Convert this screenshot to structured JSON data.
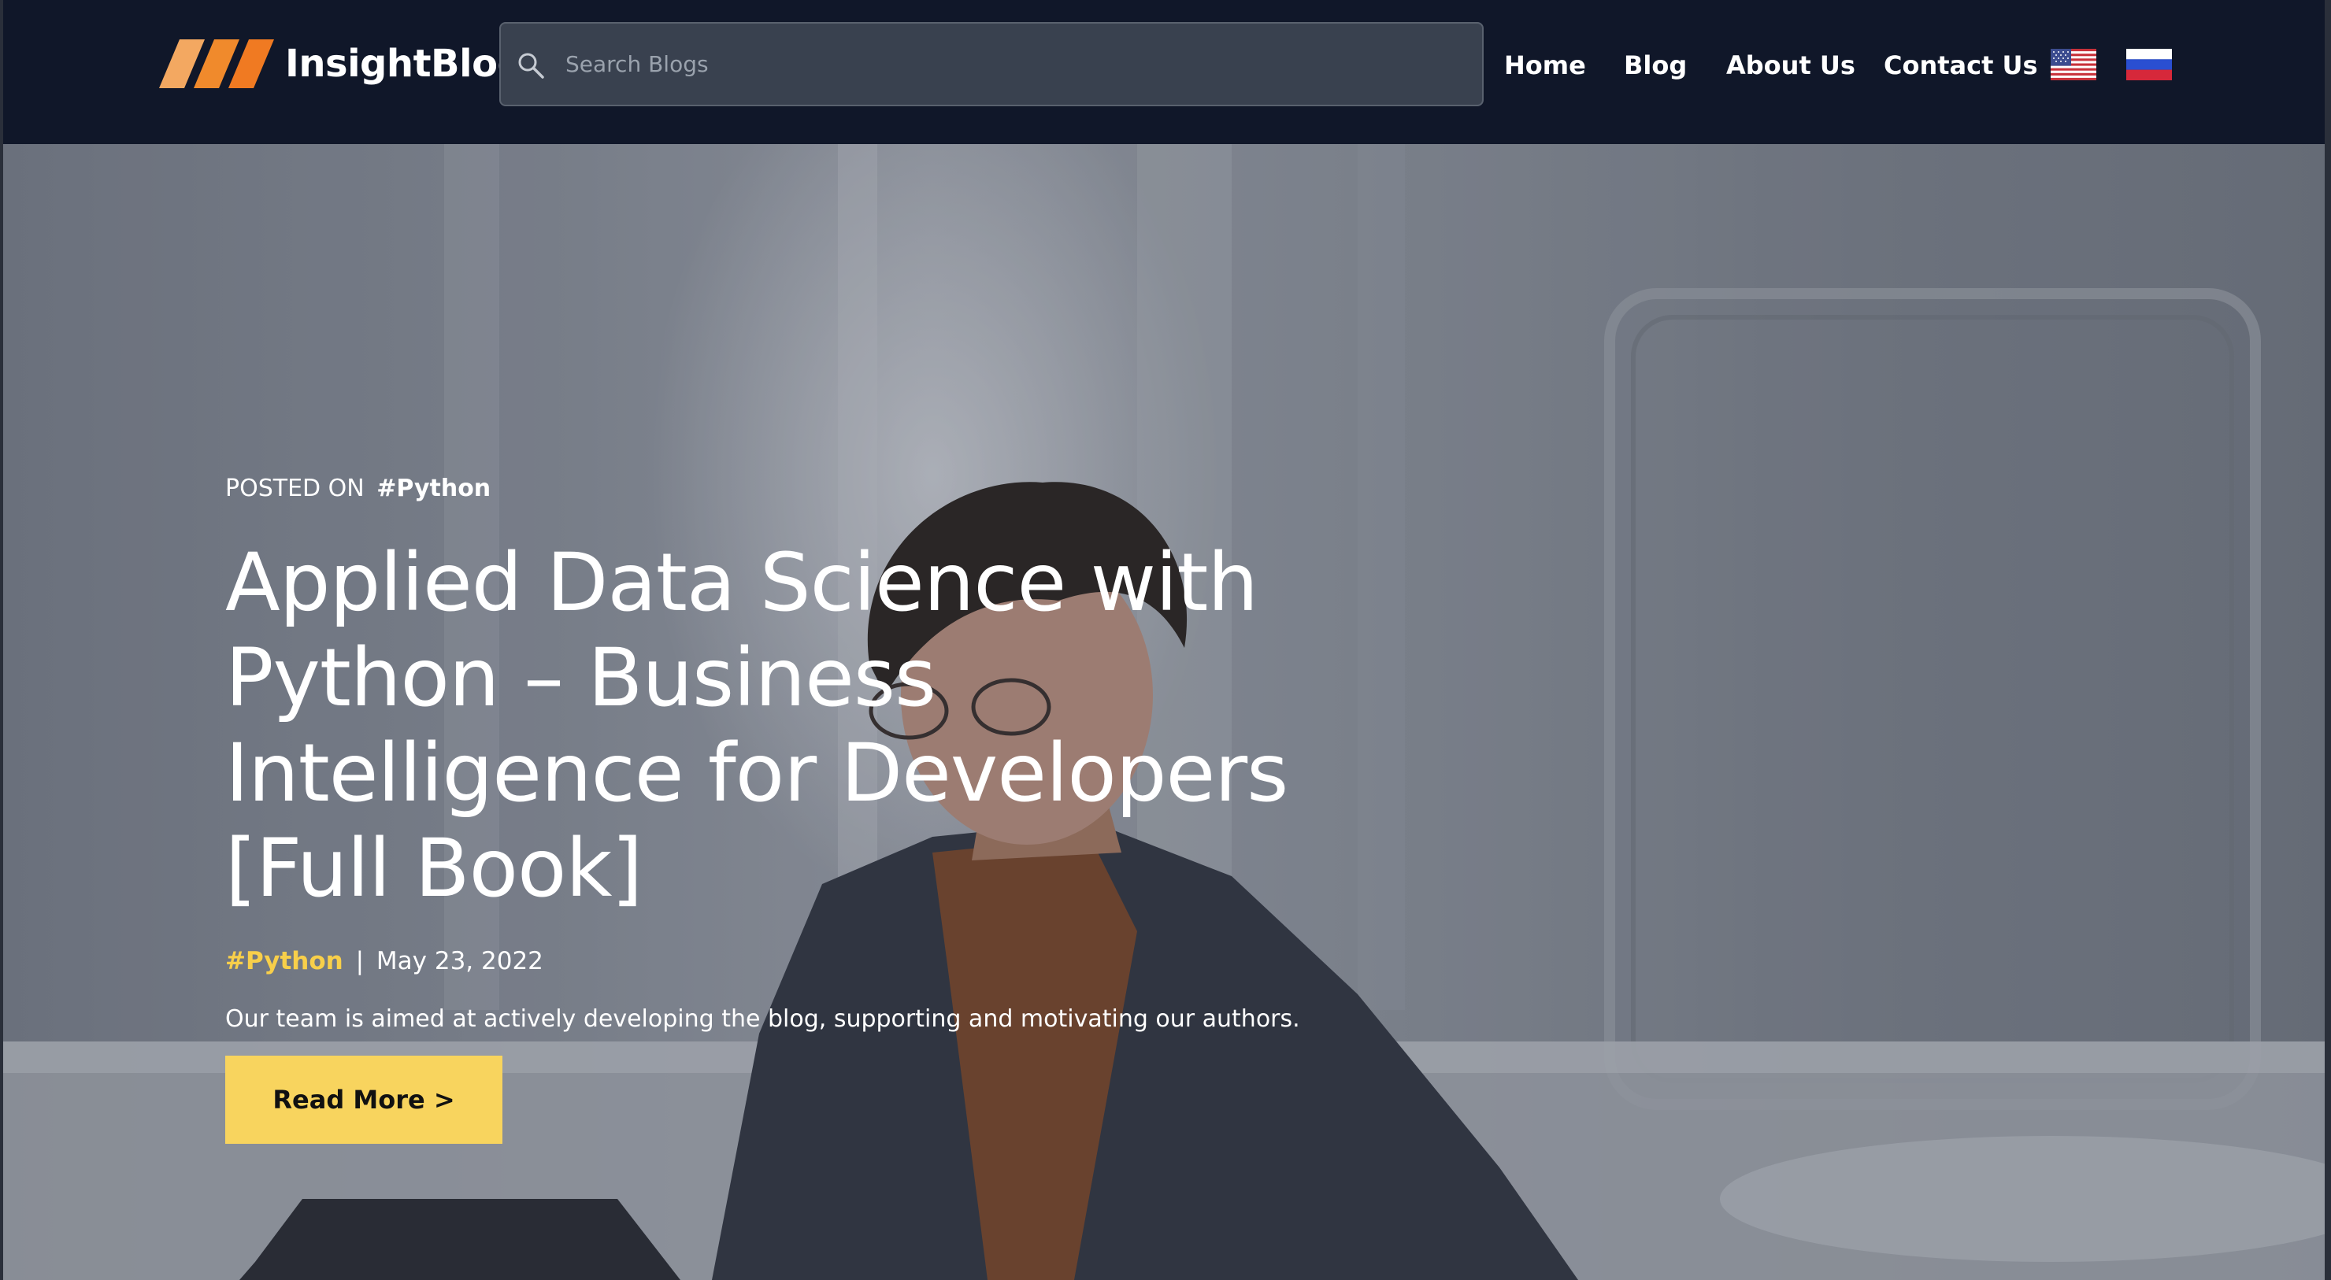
{
  "brand": {
    "name": "InsightBlog",
    "colors": {
      "stripe1": "#f3a861",
      "stripe2": "#f08a2c",
      "stripe3": "#f07a22"
    }
  },
  "search": {
    "placeholder": "Search Blogs",
    "icon": "search-icon"
  },
  "nav": {
    "home": "Home",
    "blog": "Blog",
    "about": "About Us",
    "contact": "Contact Us"
  },
  "languages": [
    {
      "icon": "us-flag-icon"
    },
    {
      "icon": "ru-flag-icon"
    }
  ],
  "hero": {
    "posted_prefix": "POSTED ON",
    "posted_tag": "#Python",
    "title": "Applied Data Science with Python – Business Intelligence for Developers [Full Book]",
    "category": "#Python",
    "separator": "|",
    "date": "May 23, 2022",
    "description": "Our team is aimed at actively developing the blog, supporting and motivating our authors.",
    "cta_label": "Read More >",
    "accent_color": "#f8cf4a",
    "cta_color": "#f8d45e"
  }
}
